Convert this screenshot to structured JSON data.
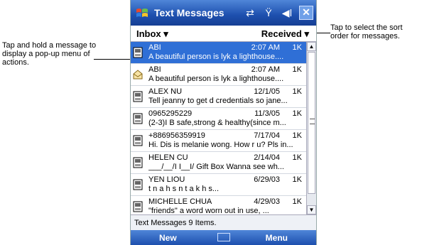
{
  "callouts": {
    "left": "Tap and hold a message to display a pop-up menu of actions.",
    "right": "Tap to select the sort order for messages."
  },
  "titlebar": {
    "title": "Text Messages",
    "icons": [
      "windows-flag-icon",
      "connectivity-icon",
      "signal-icon",
      "volume-icon",
      "close-icon"
    ],
    "close_label": "✕"
  },
  "filter": {
    "folder": "Inbox ▾",
    "sort": "Received ▾"
  },
  "messages": [
    {
      "from": "ABI",
      "date": "2:07 AM",
      "size": "1K",
      "preview": "A beautiful person is  lyk a  lighthouse....",
      "icon": "sms-unread-icon",
      "selected": true
    },
    {
      "from": "ABI",
      "date": "2:07 AM",
      "size": "1K",
      "preview": "A beautiful person is  lyk a  lighthouse....",
      "icon": "sms-read-icon",
      "selected": false
    },
    {
      "from": "ALEX NU",
      "date": "12/1/05",
      "size": "1K",
      "preview": "Tell jeanny to get d credentials so jane...",
      "icon": "sms-unread-icon",
      "selected": false
    },
    {
      "from": "0965295229",
      "date": "11/3/05",
      "size": "1K",
      "preview": "(2-3)I B safe,strong & healthy(since m...",
      "icon": "sms-unread-icon",
      "selected": false
    },
    {
      "from": "+886956359919",
      "date": "7/17/04",
      "size": "1K",
      "preview": "Hi. Dis is melanie wong. How r u? Pls in...",
      "icon": "sms-unread-icon",
      "selected": false
    },
    {
      "from": "HELEN CU",
      "date": "2/14/04",
      "size": "1K",
      "preview": "___/__/I I__I/ Gift Box Wanna see wh...",
      "icon": "sms-unread-icon",
      "selected": false
    },
    {
      "from": "YEN LIOU",
      "date": "6/29/03",
      "size": "1K",
      "preview": "t  n  a  h  s    n t  a    k  h    s...",
      "icon": "sms-unread-icon",
      "selected": false
    },
    {
      "from": "MICHELLE CHUA",
      "date": "4/29/03",
      "size": "1K",
      "preview": "\"friends\"   a word worn out in use,  ...",
      "icon": "sms-unread-icon",
      "selected": false
    }
  ],
  "status": "Text Messages  9 Items.",
  "menubar": {
    "left": "New",
    "right": "Menu",
    "center_icon": "keyboard-icon"
  },
  "colors": {
    "accent": "#1d4fae",
    "selected": "#2f6fd6"
  }
}
